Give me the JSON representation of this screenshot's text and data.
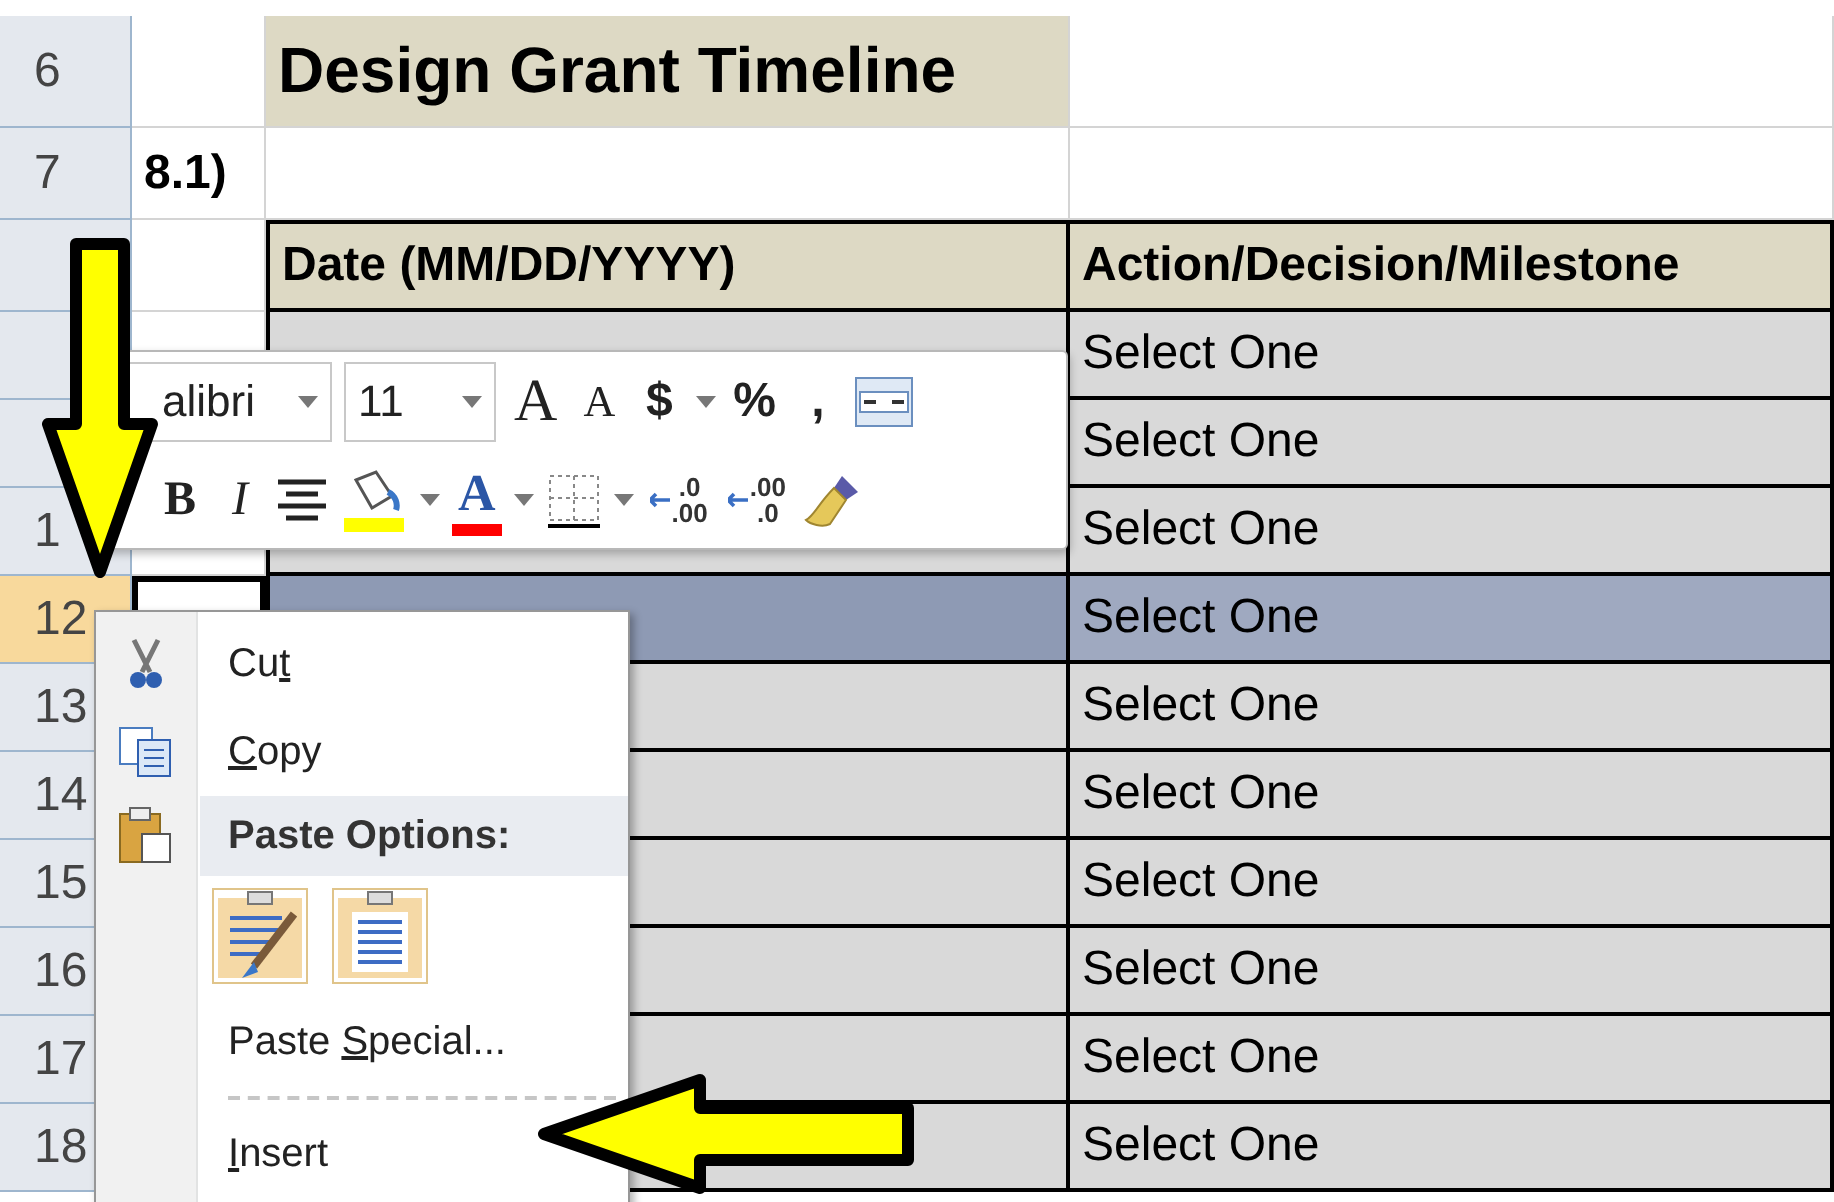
{
  "sheet": {
    "title_row": {
      "header": "6",
      "title": "Design Grant Timeline"
    },
    "section_row": {
      "header": "7",
      "label": "8.1)"
    },
    "column_headers": [
      "Date (MM/DD/YYYY)",
      "Action/Decision/Milestone"
    ],
    "data_rows": [
      {
        "action": "Select One",
        "selected": false
      },
      {
        "action": "Select One",
        "selected": false
      },
      {
        "header": "1",
        "action": "Select One",
        "selected": false
      },
      {
        "header": "12",
        "action": "Select One",
        "selected": true
      },
      {
        "header": "13",
        "action": "Select One",
        "selected": false
      },
      {
        "header": "14",
        "action": "Select One",
        "selected": false
      },
      {
        "header": "15",
        "action": "Select One",
        "selected": false
      },
      {
        "header": "16",
        "action": "Select One",
        "selected": false
      },
      {
        "header": "17",
        "action": "Select One",
        "selected": false
      },
      {
        "header": "18",
        "action": "Select One",
        "selected": false
      }
    ]
  },
  "mini_toolbar": {
    "font": "alibri",
    "size": "11",
    "row_1": [
      {
        "kind": "grow_font",
        "label": "A"
      },
      {
        "kind": "shrink_font",
        "label": "A"
      },
      {
        "kind": "glyph",
        "label": "$"
      },
      {
        "kind": "dropdown"
      },
      {
        "kind": "glyph",
        "label": "%"
      },
      {
        "kind": "glyph",
        "label": ","
      },
      {
        "kind": "merge"
      }
    ],
    "row_2": [
      {
        "kind": "bold",
        "label": "B"
      },
      {
        "kind": "italic",
        "label": "I"
      },
      {
        "kind": "center"
      },
      {
        "kind": "fill_color",
        "color": "#ffff00"
      },
      {
        "kind": "dropdown"
      },
      {
        "kind": "font_color",
        "label": "A",
        "color": "#ff0000"
      },
      {
        "kind": "dropdown"
      },
      {
        "kind": "borders"
      },
      {
        "kind": "dropdown"
      },
      {
        "kind": "decimal",
        "top": ".0",
        "bottom": ".00"
      },
      {
        "kind": "decimal",
        "top": ".00",
        "bottom": ".0"
      },
      {
        "kind": "format_painter"
      }
    ]
  },
  "context_menu": {
    "items": [
      {
        "kind": "cut",
        "before": "Cu",
        "key": "t"
      },
      {
        "kind": "copy",
        "key": "C",
        "after": "opy"
      },
      {
        "kind": "paste_header",
        "label": "Paste Options:"
      },
      {
        "kind": "paste_icons"
      },
      {
        "kind": "command",
        "before": "Paste ",
        "key": "S",
        "after": "pecial..."
      },
      {
        "kind": "separator"
      },
      {
        "kind": "command",
        "key": "I",
        "after": "nsert"
      }
    ]
  }
}
